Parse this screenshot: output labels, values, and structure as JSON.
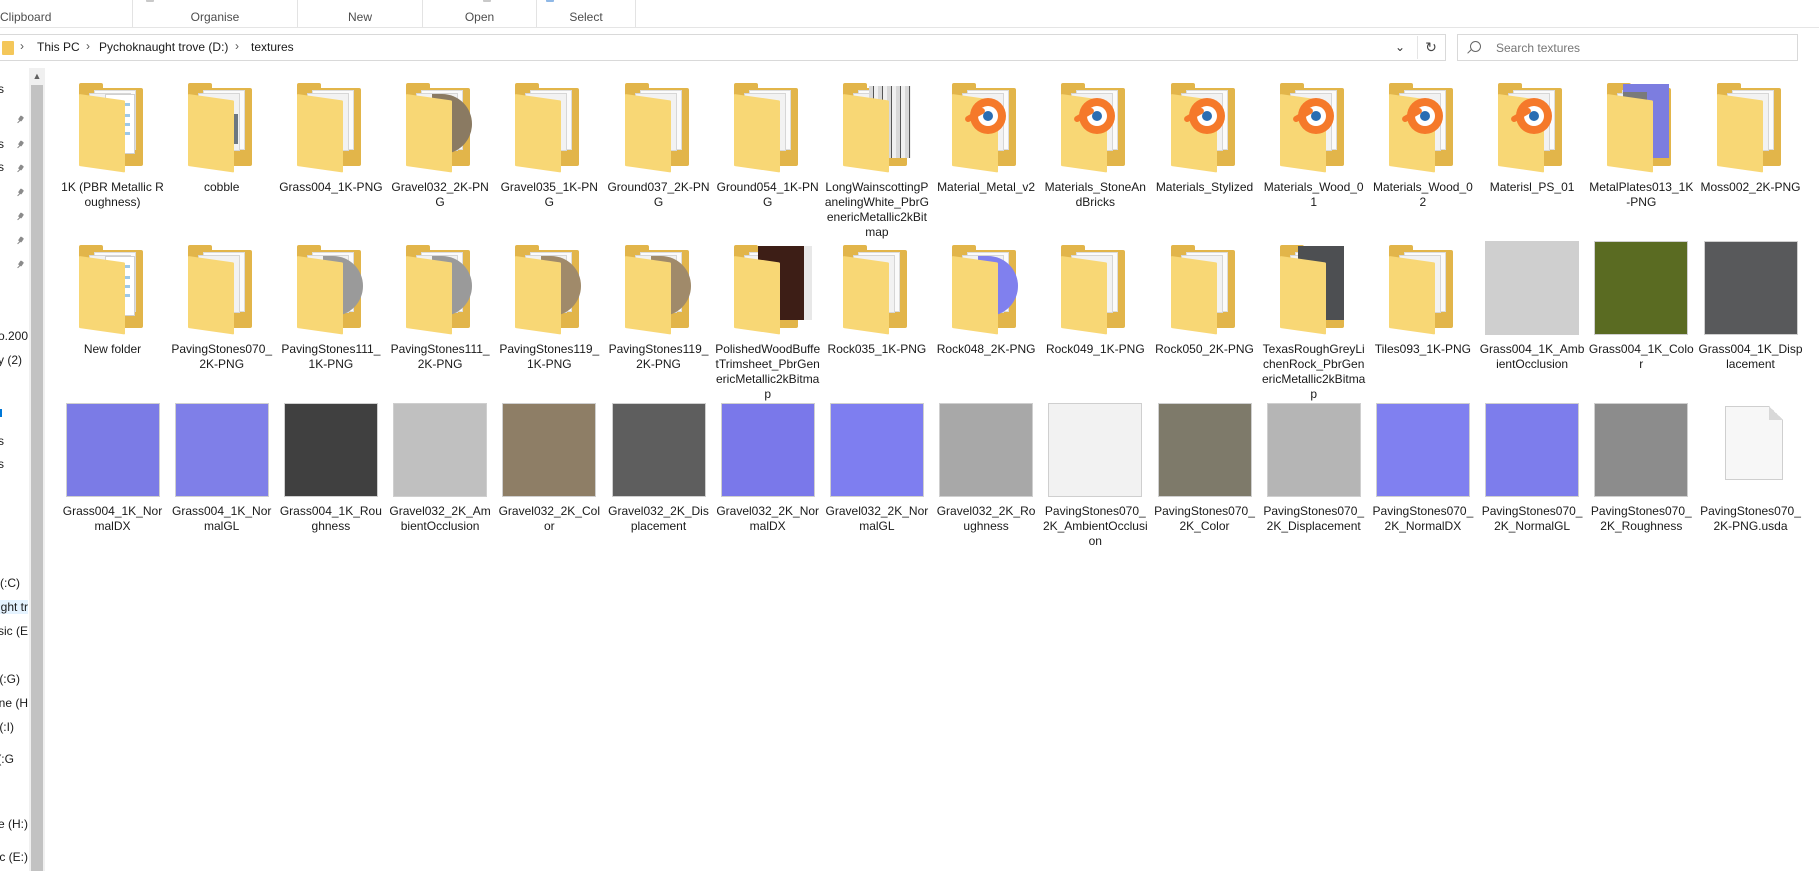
{
  "ribbon": {
    "groups": [
      {
        "label": "Clipboard"
      },
      {
        "label": "Organise"
      },
      {
        "label": "New"
      },
      {
        "label": "Open"
      },
      {
        "label": "Select"
      }
    ]
  },
  "address": {
    "crumbs": [
      "This PC",
      "Pychoknaught trove (D:)",
      "textures"
    ]
  },
  "search": {
    "placeholder": "Search textures"
  },
  "nav": {
    "items": [
      "o.200",
      "y (2)",
      "(C:)",
      "ught tr",
      "sic (E:",
      "(G:)",
      "ne (H:",
      "(I:)",
      "G:)",
      "e (H:)",
      "ic (E:)"
    ]
  },
  "files": [
    {
      "name": "1K (PBR Metallic Roughness)",
      "kind": "folder",
      "content": "doc-blue"
    },
    {
      "name": "cobble",
      "kind": "folder",
      "content": "gray-stone"
    },
    {
      "name": "Grass004_1K-PNG",
      "kind": "folder",
      "content": "white"
    },
    {
      "name": "Gravel032_2K-PNG",
      "kind": "folder",
      "content": "sphere-brown"
    },
    {
      "name": "Gravel035_1K-PNG",
      "kind": "folder",
      "content": "white"
    },
    {
      "name": "Ground037_2K-PNG",
      "kind": "folder",
      "content": "white"
    },
    {
      "name": "Ground054_1K-PNG",
      "kind": "folder",
      "content": "white"
    },
    {
      "name": "LongWainscottingPanelingWhite_PbrGenericMetallic2kBitmap",
      "kind": "folder",
      "content": "panel"
    },
    {
      "name": "Material_Metal_v2",
      "kind": "folder",
      "content": "blender"
    },
    {
      "name": "Materials_StoneAndBricks",
      "kind": "folder",
      "content": "blender"
    },
    {
      "name": "Materials_Stylized",
      "kind": "folder",
      "content": "blender"
    },
    {
      "name": "Materials_Wood_01",
      "kind": "folder",
      "content": "blender"
    },
    {
      "name": "Materials_Wood_02",
      "kind": "folder",
      "content": "blender"
    },
    {
      "name": "Materisl_PS_01",
      "kind": "folder",
      "content": "blender"
    },
    {
      "name": "MetalPlates013_1K-PNG",
      "kind": "folder",
      "content": "metal-blue"
    },
    {
      "name": "Moss002_2K-PNG",
      "kind": "folder",
      "content": "white"
    },
    {
      "name": "New folder",
      "kind": "folder",
      "content": "doc-blue"
    },
    {
      "name": "PavingStones070_2K-PNG",
      "kind": "folder",
      "content": "white"
    },
    {
      "name": "PavingStones111_1K-PNG",
      "kind": "folder",
      "content": "sphere-gray"
    },
    {
      "name": "PavingStones111_2K-PNG",
      "kind": "folder",
      "content": "sphere-gray"
    },
    {
      "name": "PavingStones119_1K-PNG",
      "kind": "folder",
      "content": "sphere-tan"
    },
    {
      "name": "PavingStones119_2K-PNG",
      "kind": "folder",
      "content": "sphere-tan"
    },
    {
      "name": "PolishedWoodBuffetTrimsheet_PbrGenericMetallic2kBitmap",
      "kind": "folder",
      "content": "wood"
    },
    {
      "name": "Rock035_1K-PNG",
      "kind": "folder",
      "content": "white"
    },
    {
      "name": "Rock048_2K-PNG",
      "kind": "folder",
      "content": "sphere-normal"
    },
    {
      "name": "Rock049_1K-PNG",
      "kind": "folder",
      "content": "white"
    },
    {
      "name": "Rock050_2K-PNG",
      "kind": "folder",
      "content": "white"
    },
    {
      "name": "TexasRoughGreyLichenRock_PbrGenericMetallic2kBitmap",
      "kind": "folder",
      "content": "lichen"
    },
    {
      "name": "Tiles093_1K-PNG",
      "kind": "folder",
      "content": "white"
    },
    {
      "name": "Grass004_1K_AmbientOcclusion",
      "kind": "image",
      "color": "#cfcfcf"
    },
    {
      "name": "Grass004_1K_Color",
      "kind": "image",
      "color": "#5a6b22"
    },
    {
      "name": "Grass004_1K_Displacement",
      "kind": "image",
      "color": "#58595b"
    },
    {
      "name": "Grass004_1K_NormalDX",
      "kind": "image",
      "color": "#7b7be6"
    },
    {
      "name": "Grass004_1K_NormalGL",
      "kind": "image",
      "color": "#7f7fe8"
    },
    {
      "name": "Grass004_1K_Roughness",
      "kind": "image",
      "color": "#404040"
    },
    {
      "name": "Gravel032_2K_AmbientOcclusion",
      "kind": "image",
      "color": "#c0c0c0"
    },
    {
      "name": "Gravel032_2K_Color",
      "kind": "image",
      "color": "#8e7e66"
    },
    {
      "name": "Gravel032_2K_Displacement",
      "kind": "image",
      "color": "#5e5e5e"
    },
    {
      "name": "Gravel032_2K_NormalDX",
      "kind": "image",
      "color": "#7a78ea"
    },
    {
      "name": "Gravel032_2K_NormalGL",
      "kind": "image",
      "color": "#7e7ef0"
    },
    {
      "name": "Gravel032_2K_Roughness",
      "kind": "image",
      "color": "#a8a8a8"
    },
    {
      "name": "PavingStones070_2K_AmbientOcclusion",
      "kind": "image",
      "color": "#f2f2f2"
    },
    {
      "name": "PavingStones070_2K_Color",
      "kind": "image",
      "color": "#7e7a6a"
    },
    {
      "name": "PavingStones070_2K_Displacement",
      "kind": "image",
      "color": "#b5b5b5"
    },
    {
      "name": "PavingStones070_2K_NormalDX",
      "kind": "image",
      "color": "#8080f0"
    },
    {
      "name": "PavingStones070_2K_NormalGL",
      "kind": "image",
      "color": "#7d7dec"
    },
    {
      "name": "PavingStones070_2K_Roughness",
      "kind": "image",
      "color": "#8c8c8c"
    },
    {
      "name": "PavingStones070_2K-PNG.usda",
      "kind": "file"
    }
  ],
  "colors": {
    "folder_back": "#e2b54a",
    "folder_front": "#f8d775",
    "accent": "#0078d7"
  }
}
